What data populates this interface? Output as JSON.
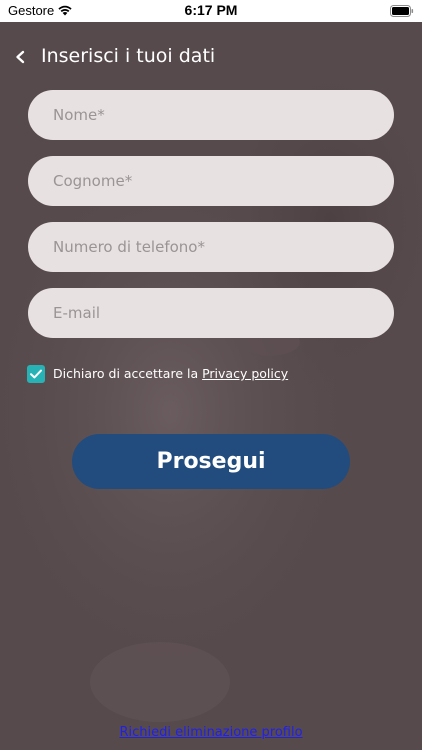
{
  "status_bar": {
    "carrier": "Gestore",
    "time": "6:17 PM",
    "wifi_icon": "wifi-icon",
    "battery_icon": "battery-full-icon"
  },
  "header": {
    "back_icon": "chevron-left-icon",
    "title": "Inserisci i tuoi dati"
  },
  "form": {
    "fields": [
      {
        "name": "first-name-field",
        "value": "",
        "placeholder": "Nome*"
      },
      {
        "name": "last-name-field",
        "value": "",
        "placeholder": "Cognome*"
      },
      {
        "name": "phone-field",
        "value": "",
        "placeholder": "Numero di telefono*"
      },
      {
        "name": "email-field",
        "value": "",
        "placeholder": "E-mail"
      }
    ],
    "consent": {
      "checked": true,
      "text": "Dichiaro di accettare la ",
      "link": "Privacy policy"
    },
    "submit_label": "Prosegui"
  },
  "footer": {
    "delete_profile_link": "Richiedi eliminazione profilo"
  },
  "colors": {
    "overlay": "#564a4c",
    "field_bg": "#e7e1e1",
    "button": "#214c7d",
    "checkbox": "#27b3b6",
    "link": "#2020ee"
  }
}
